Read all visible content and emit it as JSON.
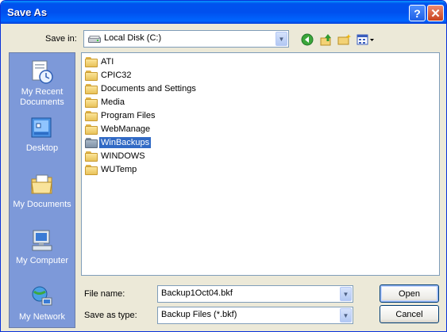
{
  "window": {
    "title": "Save As",
    "help_glyph": "?",
    "close_glyph": "✕"
  },
  "toolbar": {
    "save_in_label": "Save in:",
    "save_in_value": "Local Disk (C:)",
    "back_icon": "back-arrow-icon",
    "up_icon": "up-one-level-icon",
    "new_folder_icon": "new-folder-icon",
    "views_icon": "views-menu-icon"
  },
  "places": [
    {
      "label": "My Recent Documents",
      "icon": "recent-documents-icon"
    },
    {
      "label": "Desktop",
      "icon": "desktop-icon"
    },
    {
      "label": "My Documents",
      "icon": "my-documents-icon"
    },
    {
      "label": "My Computer",
      "icon": "my-computer-icon"
    },
    {
      "label": "My Network",
      "icon": "my-network-icon"
    }
  ],
  "files": [
    {
      "name": "ATI",
      "selected": false
    },
    {
      "name": "CPIC32",
      "selected": false
    },
    {
      "name": "Documents and Settings",
      "selected": false
    },
    {
      "name": "Media",
      "selected": false
    },
    {
      "name": "Program Files",
      "selected": false
    },
    {
      "name": "WebManage",
      "selected": false
    },
    {
      "name": "WinBackups",
      "selected": true
    },
    {
      "name": "WINDOWS",
      "selected": false
    },
    {
      "name": "WUTemp",
      "selected": false
    }
  ],
  "filename": {
    "label": "File name:",
    "value": "Backup1Oct04.bkf"
  },
  "filetype": {
    "label": "Save as type:",
    "value": "Backup Files (*.bkf)"
  },
  "buttons": {
    "open": "Open",
    "cancel": "Cancel"
  },
  "colors": {
    "title_bar": "#0053ee",
    "places_bar": "#7d99d9",
    "selection": "#316ac5",
    "dialog_bg": "#ece9d8"
  }
}
